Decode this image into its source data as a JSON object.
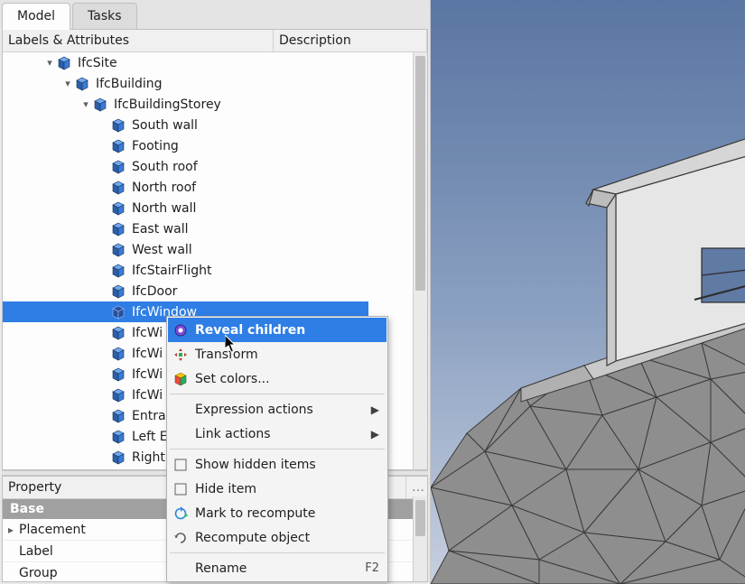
{
  "tabs": {
    "model": "Model",
    "tasks": "Tasks"
  },
  "tree_header": {
    "labels": "Labels & Attributes",
    "description": "Description"
  },
  "tree": {
    "site": "IfcSite",
    "building": "IfcBuilding",
    "storey": "IfcBuildingStorey",
    "items": [
      "South wall",
      "Footing",
      "South roof",
      "North roof",
      "North wall",
      "East wall",
      "West wall",
      "IfcStairFlight",
      "IfcDoor",
      "IfcWindow",
      "IfcWi",
      "IfcWi",
      "IfcWi",
      "IfcWi",
      "Entra",
      "Left E",
      "Right"
    ],
    "selected_index": 9
  },
  "context_menu": {
    "reveal_children": "Reveal children",
    "transform": "Transform",
    "set_colors": "Set colors...",
    "expression_actions": "Expression actions",
    "link_actions": "Link actions",
    "show_hidden_items": "Show hidden items",
    "hide_item": "Hide item",
    "mark_to_recompute": "Mark to recompute",
    "recompute_object": "Recompute object",
    "rename": "Rename",
    "rename_accel": "F2"
  },
  "properties": {
    "header": "Property",
    "group": "Base",
    "rows": [
      {
        "label": "Placement",
        "expandable": true
      },
      {
        "label": "Label"
      },
      {
        "label": "Group"
      }
    ]
  }
}
